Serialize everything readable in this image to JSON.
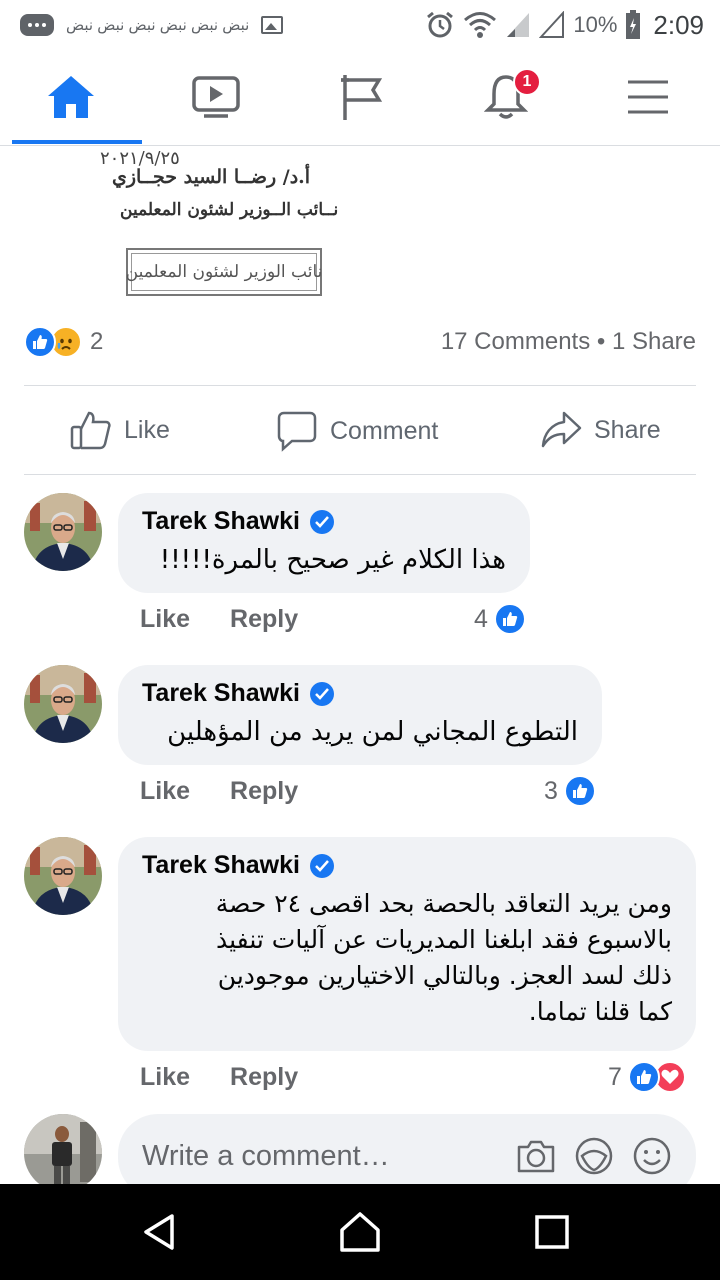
{
  "status_bar": {
    "notification_text": "نبض نبض نبض نبض نبض نبض",
    "battery": "10%",
    "time": "2:09"
  },
  "nav": {
    "notification_badge": "1",
    "tabs": [
      "home-icon",
      "video-icon",
      "flag-icon",
      "bell-icon",
      "menu-icon"
    ]
  },
  "post_image": {
    "date": "٢٠٢١/٩/٢٥",
    "signer_name": "أ.د/ رضــا السيد حجــازي",
    "signer_title": "نــائب الــوزير لشئون المعلمين",
    "stamp_text": "نائب الوزير لشئون المعلمين"
  },
  "post_stats": {
    "reaction_count": "2",
    "comments_shares": "17 Comments • 1 Share"
  },
  "post_actions": {
    "like": "Like",
    "comment": "Comment",
    "share": "Share"
  },
  "comments": [
    {
      "author": "Tarek Shawki",
      "text": "هذا الكلام غير صحيح بالمرة!!!!!",
      "like_label": "Like",
      "reply_label": "Reply",
      "reaction_count": "4"
    },
    {
      "author": "Tarek Shawki",
      "text": "التطوع المجاني لمن يريد من المؤهلين",
      "like_label": "Like",
      "reply_label": "Reply",
      "reaction_count": "3"
    },
    {
      "author": "Tarek Shawki",
      "text_lines": [
        "ومن يريد التعاقد بالحصة بحد اقصى ٢٤ حصة",
        "بالاسبوع فقد ابلغنا المديريات عن آليات تنفيذ",
        "ذلك لسد العجز. وبالتالي الاختيارين موجودين",
        "كما قلنا تماما."
      ],
      "like_label": "Like",
      "reply_label": "Reply",
      "reaction_count": "7"
    }
  ],
  "write_comment": {
    "placeholder": "Write a comment…"
  },
  "colors": {
    "accent": "#1877f2",
    "love": "#f33e58",
    "sad": "#f7b125",
    "bubble": "#f0f2f5"
  }
}
